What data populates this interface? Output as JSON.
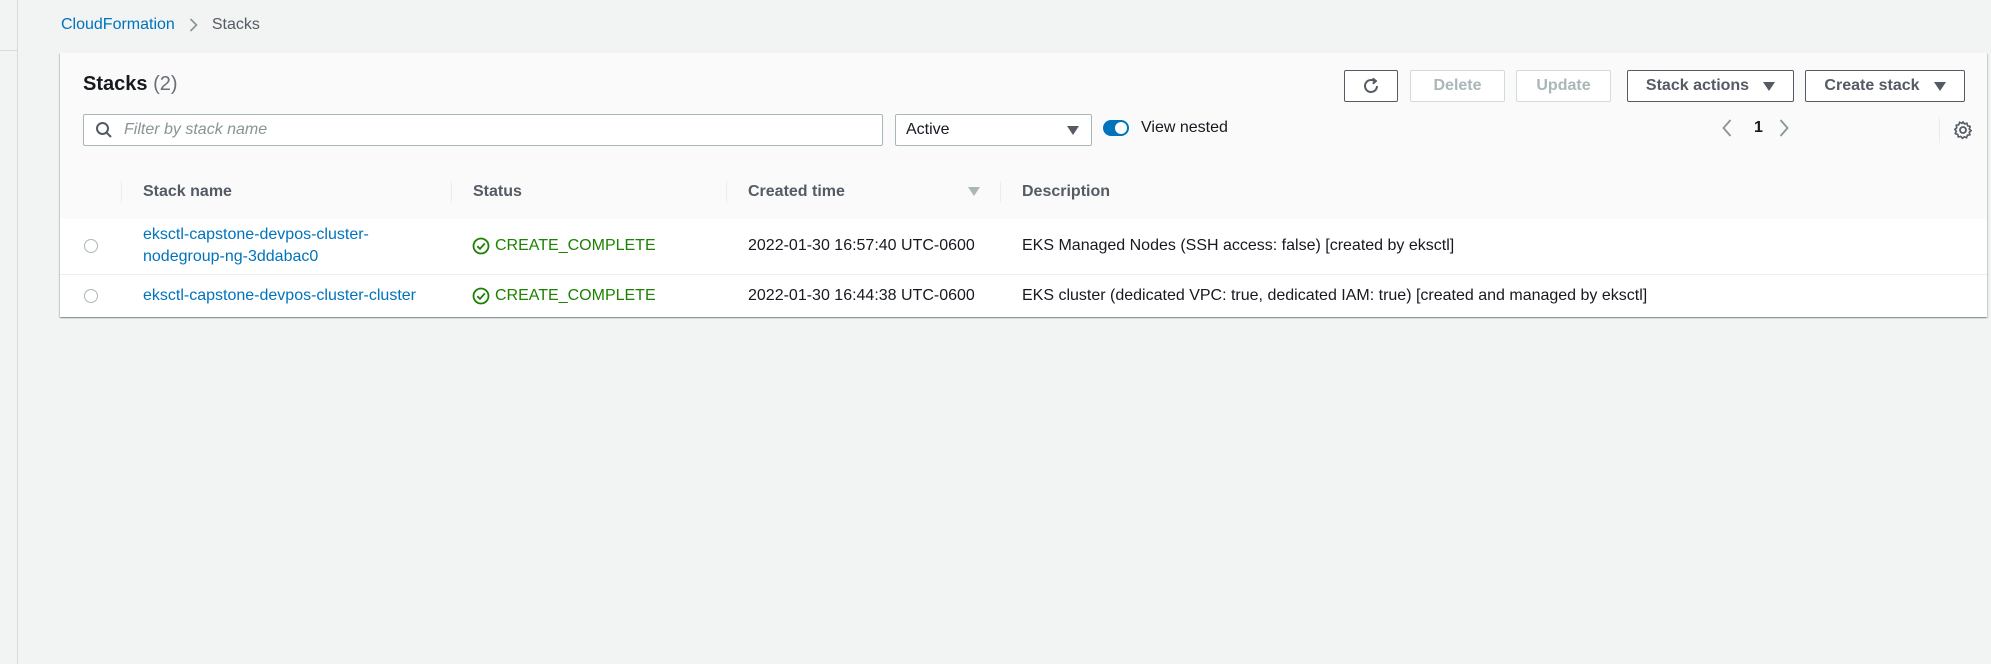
{
  "breadcrumb": {
    "items": [
      {
        "label": "CloudFormation"
      },
      {
        "label": "Stacks"
      }
    ]
  },
  "panel": {
    "title": "Stacks",
    "count": "(2)"
  },
  "toolbar": {
    "refresh_icon": "refresh-icon",
    "delete_label": "Delete",
    "update_label": "Update",
    "stack_actions_label": "Stack actions",
    "create_stack_label": "Create stack"
  },
  "filter": {
    "search_placeholder": "Filter by stack name",
    "search_value": "",
    "status_select": "Active",
    "view_nested_label": "View nested",
    "view_nested_on": true
  },
  "pagination": {
    "current_page": "1"
  },
  "table": {
    "columns": [
      {
        "label": "Stack name"
      },
      {
        "label": "Status"
      },
      {
        "label": "Created time"
      },
      {
        "label": "Description"
      }
    ],
    "rows": [
      {
        "name_line1": "eksctl-capstone-devpos-cluster-",
        "name_line2": "nodegroup-ng-3ddabac0",
        "status": "CREATE_COMPLETE",
        "created": "2022-01-30 16:57:40 UTC-0600",
        "description": "EKS Managed Nodes (SSH access: false) [created by eksctl]"
      },
      {
        "name_line1": "eksctl-capstone-devpos-cluster-cluster",
        "status": "CREATE_COMPLETE",
        "created": "2022-01-30 16:44:38 UTC-0600",
        "description": "EKS cluster (dedicated VPC: true, dedicated IAM: true) [created and managed by eksctl]"
      }
    ]
  },
  "colors": {
    "link": "#0073bb",
    "success": "#1d8102",
    "toggle": "#0073bb",
    "page_bg": "#f2f3f3"
  }
}
